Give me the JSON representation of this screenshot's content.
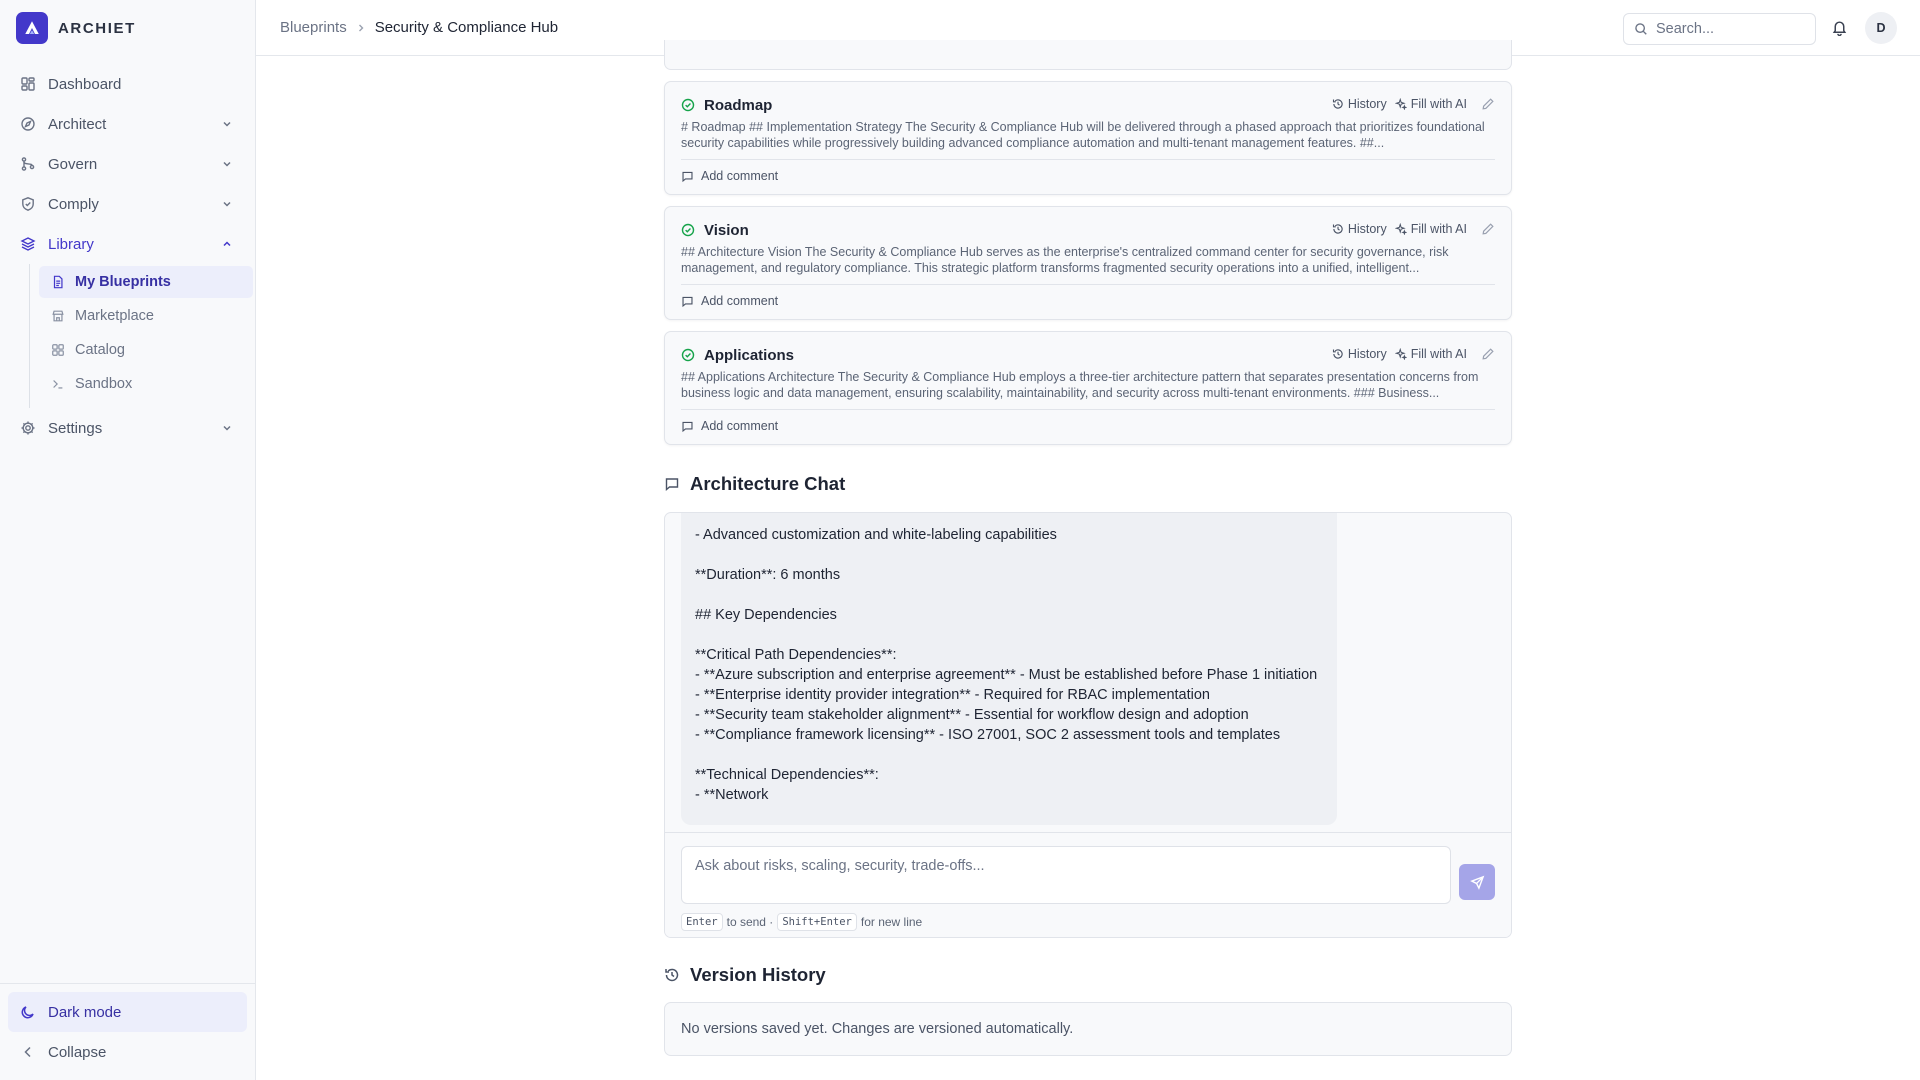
{
  "brand": {
    "name": "ARCHIET"
  },
  "sidebar": {
    "items": [
      {
        "label": "Dashboard"
      },
      {
        "label": "Architect"
      },
      {
        "label": "Govern"
      },
      {
        "label": "Comply"
      },
      {
        "label": "Library"
      }
    ],
    "library_sub": [
      {
        "label": "My Blueprints"
      },
      {
        "label": "Marketplace"
      },
      {
        "label": "Catalog"
      },
      {
        "label": "Sandbox"
      }
    ],
    "settings": "Settings",
    "dark_mode": "Dark mode",
    "collapse": "Collapse"
  },
  "topbar": {
    "breadcrumb_root": "Blueprints",
    "breadcrumb_current": "Security & Compliance Hub",
    "search_placeholder": "Search...",
    "avatar_initial": "D"
  },
  "sections": [
    {
      "title": "Roadmap",
      "history": "History",
      "fill_ai": "Fill with AI",
      "body": "# Roadmap ## Implementation Strategy The Security & Compliance Hub will be delivered through a phased approach that prioritizes foundational security capabilities while progressively building advanced compliance automation and multi-tenant management features. ##...",
      "comment": "Add comment"
    },
    {
      "title": "Vision",
      "history": "History",
      "fill_ai": "Fill with AI",
      "body": "## Architecture Vision The Security & Compliance Hub serves as the enterprise's centralized command center for security governance, risk management, and regulatory compliance. This strategic platform transforms fragmented security operations into a unified, intelligent...",
      "comment": "Add comment"
    },
    {
      "title": "Applications",
      "history": "History",
      "fill_ai": "Fill with AI",
      "body": "## Applications Architecture The Security & Compliance Hub employs a three-tier architecture pattern that separates presentation concerns from business logic and data management, ensuring scalability, maintainability, and security across multi-tenant environments. ### Business...",
      "comment": "Add comment"
    }
  ],
  "chat": {
    "heading": "Architecture Chat",
    "message": "- Advanced customization and white-labeling capabilities\n\n**Duration**: 6 months\n\n## Key Dependencies\n\n**Critical Path Dependencies**:\n- **Azure subscription and enterprise agreement** - Must be established before Phase 1 initiation\n- **Enterprise identity provider integration** - Required for RBAC implementation\n- **Security team stakeholder alignment** - Essential for workflow design and adoption\n- **Compliance framework licensing** - ISO 27001, SOC 2 assessment tools and templates\n\n**Technical Dependencies**:\n- **Network",
    "input_placeholder": "Ask about risks, scaling, security, trade-offs...",
    "hint_enter": "Enter",
    "hint_send": "to send ·",
    "hint_shift": "Shift+Enter",
    "hint_newline": "for new line"
  },
  "versions": {
    "heading": "Version History",
    "empty": "No versions saved yet. Changes are versioned automatically."
  },
  "colors": {
    "accent": "#4338ca",
    "success": "#16a34a"
  }
}
